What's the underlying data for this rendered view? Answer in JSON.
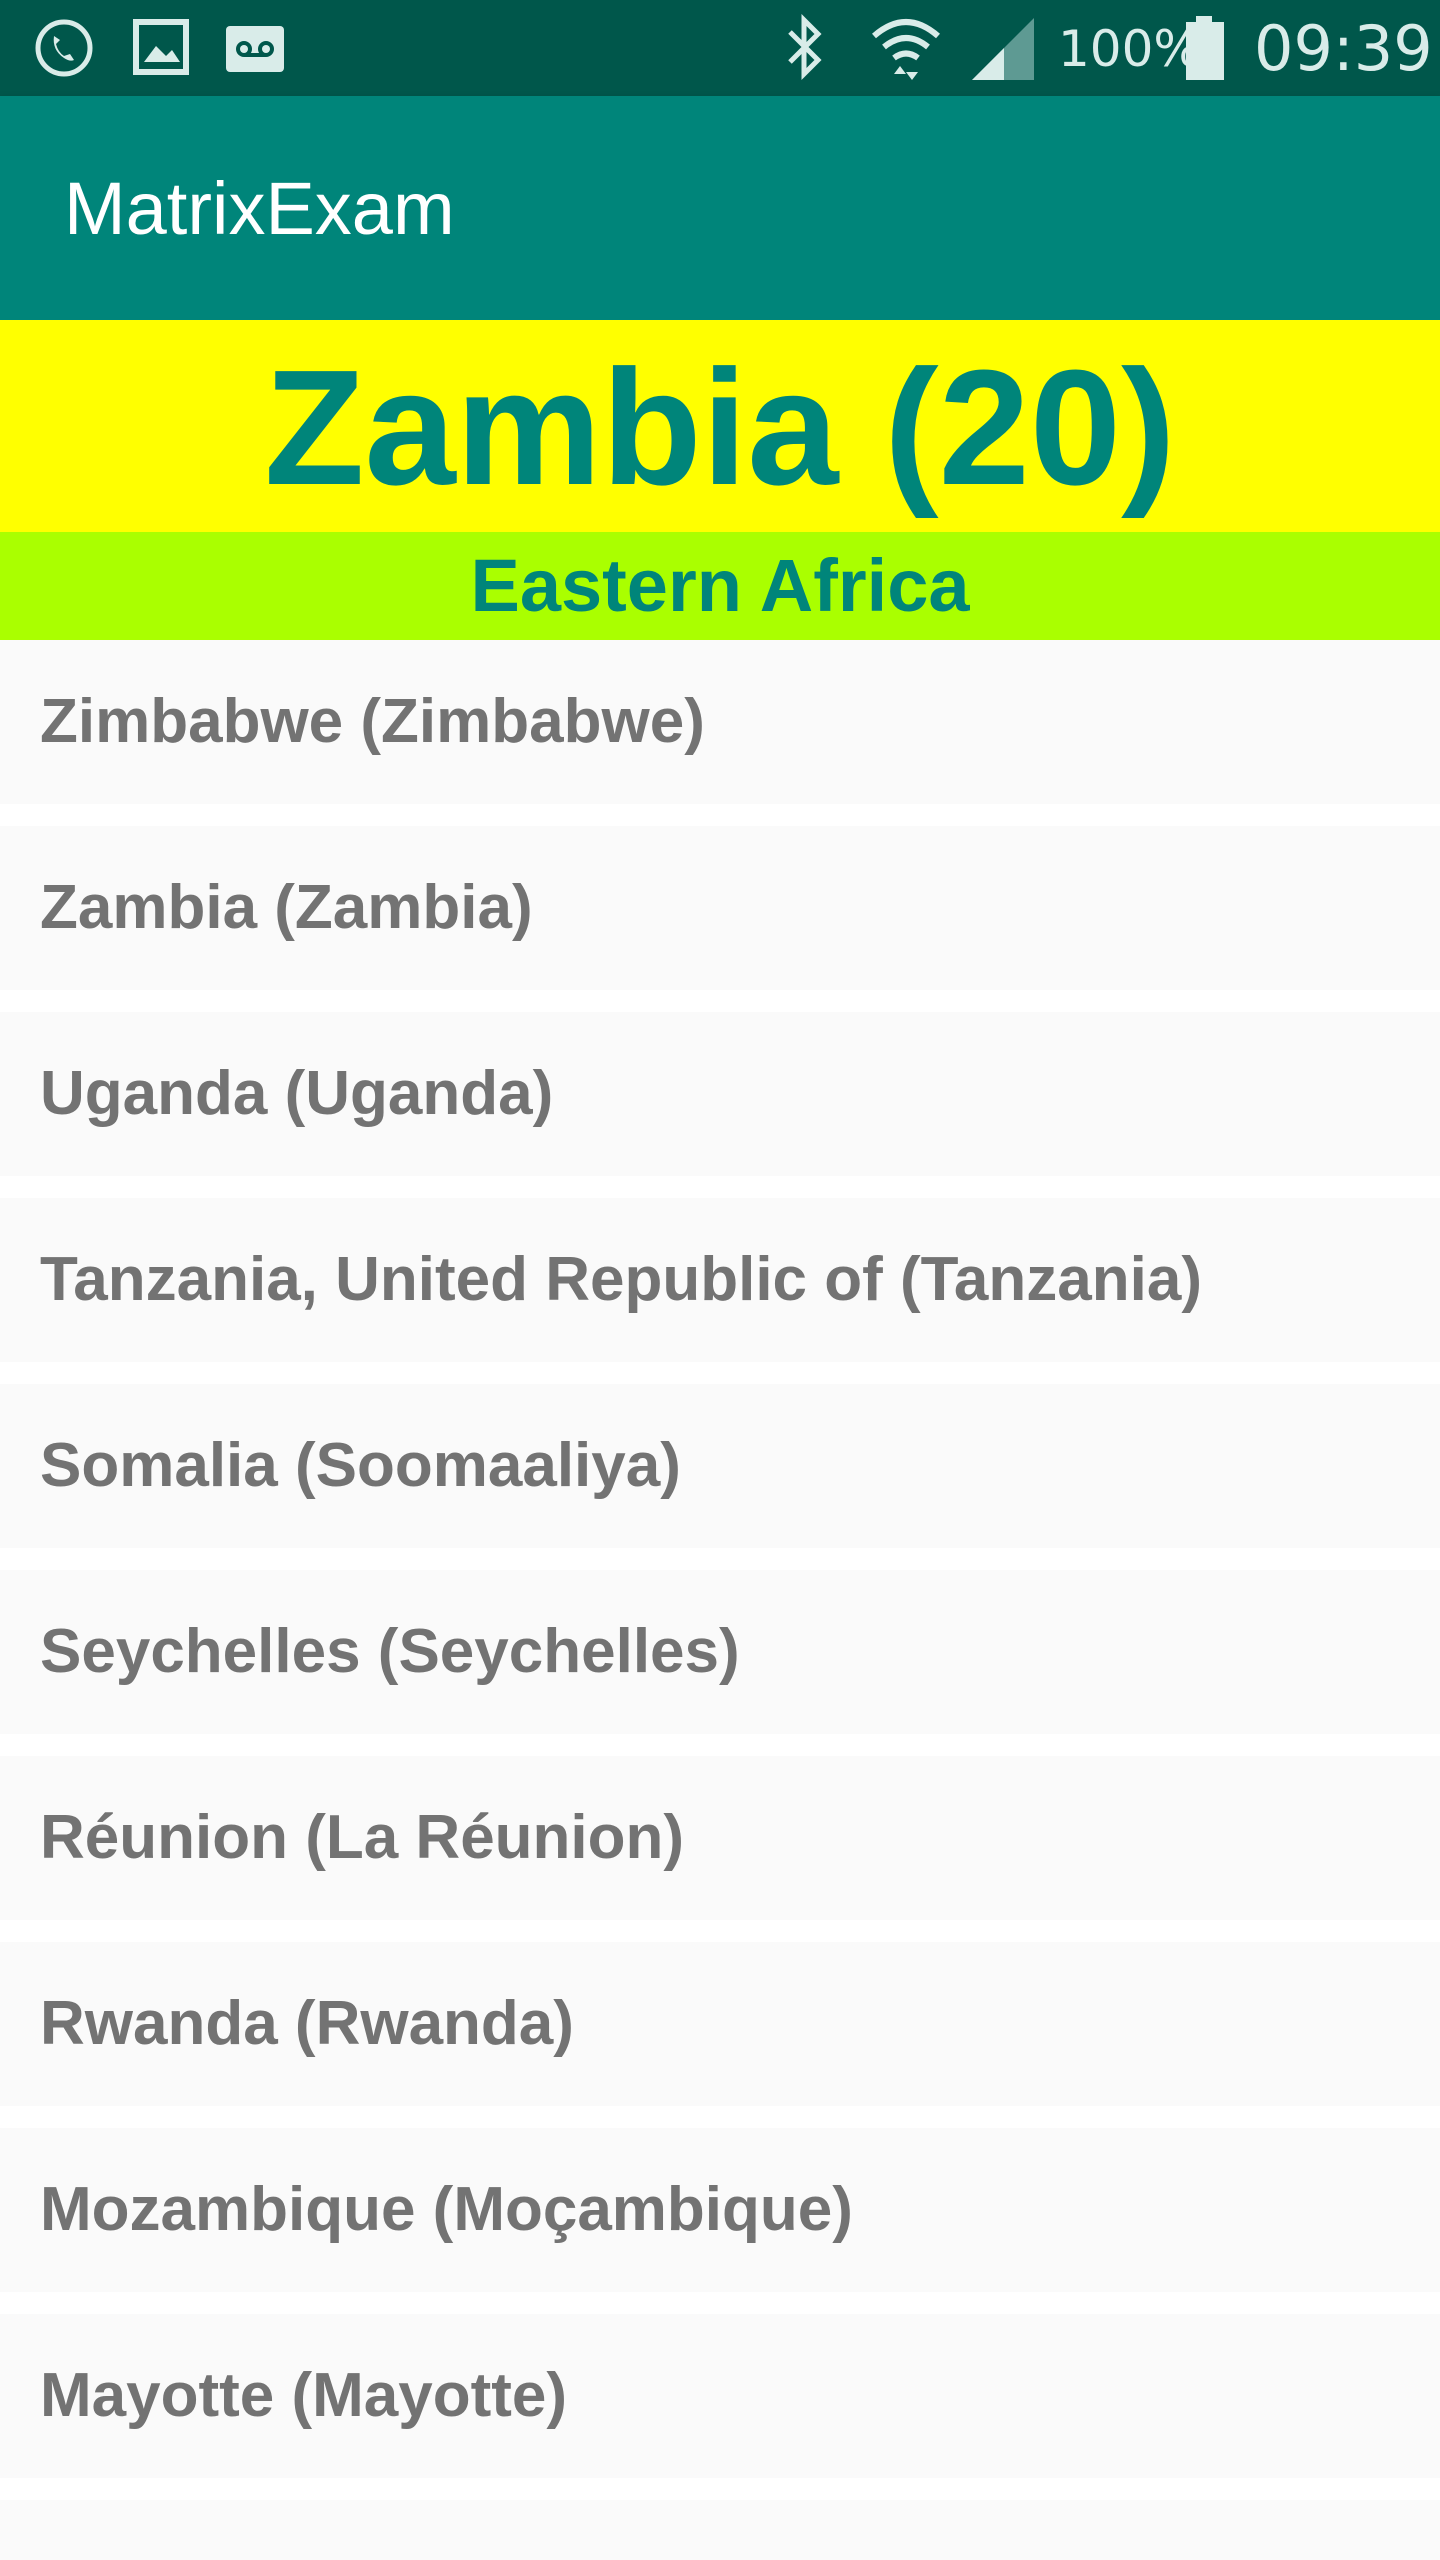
{
  "status_bar": {
    "battery": "100%",
    "time": "09:39",
    "icons": [
      "phone-call-icon",
      "image-icon",
      "voicemail-icon",
      "bluetooth-icon",
      "wifi-icon",
      "cell-signal-icon",
      "battery-icon"
    ]
  },
  "app_bar": {
    "title": "MatrixExam"
  },
  "header": {
    "country": "Zambia (20)",
    "region": "Eastern Africa"
  },
  "list": {
    "items": [
      {
        "label": "Zimbabwe (Zimbabwe)"
      },
      {
        "label": "Zambia (Zambia)"
      },
      {
        "label": "Uganda (Uganda)"
      },
      {
        "label": "Tanzania, United Republic of (Tanzania)"
      },
      {
        "label": "Somalia (Soomaaliya)"
      },
      {
        "label": "Seychelles (Seychelles)"
      },
      {
        "label": "Réunion (La Réunion)"
      },
      {
        "label": "Rwanda (Rwanda)"
      },
      {
        "label": "Mozambique (Moçambique)"
      },
      {
        "label": "Mayotte (Mayotte)"
      }
    ]
  },
  "colors": {
    "status_bar": "#00574b",
    "app_bar": "#00857a",
    "country_bg": "#ffff00",
    "region_bg": "#aaff00",
    "accent_text": "#00857a",
    "list_text": "#737373"
  }
}
